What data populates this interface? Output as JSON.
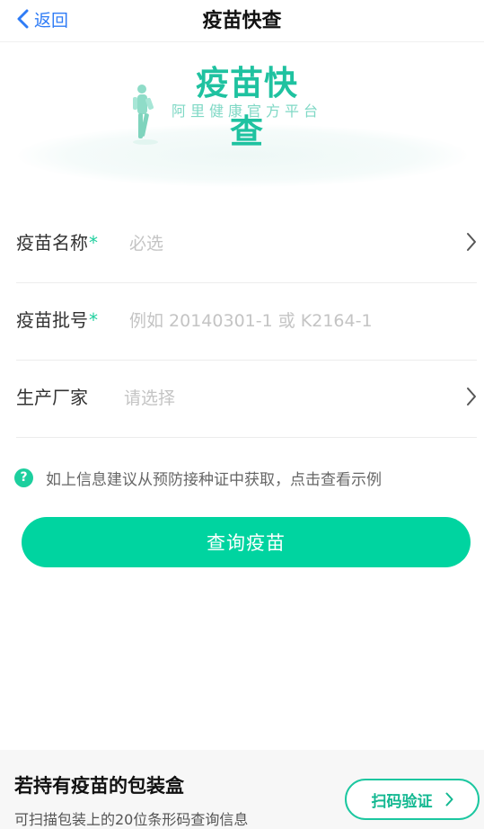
{
  "nav": {
    "back_label": "返回",
    "title": "疫苗快查"
  },
  "banner": {
    "title": "疫苗快查",
    "subtitle": "阿里健康官方平台"
  },
  "form": {
    "vaccine_name": {
      "label": "疫苗名称",
      "required_mark": "*",
      "placeholder": "必选"
    },
    "batch_number": {
      "label": "疫苗批号",
      "required_mark": "*",
      "placeholder": "例如 20140301-1 或 K2164-1"
    },
    "manufacturer": {
      "label": "生产厂家",
      "placeholder": "请选择"
    }
  },
  "hint": {
    "icon": "question-icon",
    "text": "如上信息建议从预防接种证中获取，点击查看示例"
  },
  "query_button": {
    "label": "查询疫苗"
  },
  "footer": {
    "title": "若持有疫苗的包装盒",
    "subtitle": "可扫描包装上的20位条形码查询信息",
    "scan_button": "扫码验证"
  },
  "colors": {
    "accent": "#00d4a0",
    "link_blue": "#2f7cf6",
    "banner_green": "#1fc2a0"
  }
}
